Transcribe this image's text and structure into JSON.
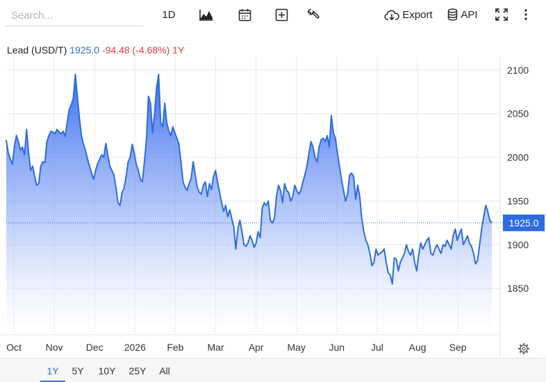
{
  "toolbar": {
    "search_placeholder": "Search...",
    "interval_label": "1D",
    "export_label": "Export",
    "api_label": "API",
    "icons": [
      "area-chart-icon",
      "calendar-icon",
      "plus-box-icon",
      "wrench-icon",
      "cloud-download-icon",
      "database-icon",
      "fullscreen-icon",
      "more-vertical-icon"
    ]
  },
  "instrument": {
    "name": "Lead (USD/T)",
    "price": "1925.0",
    "change": "-94.48 (-4.68%)",
    "range": "1Y"
  },
  "range_buttons": [
    {
      "label": "1Y",
      "active": true
    },
    {
      "label": "5Y",
      "active": false
    },
    {
      "label": "10Y",
      "active": false
    },
    {
      "label": "25Y",
      "active": false
    },
    {
      "label": "All",
      "active": false
    }
  ],
  "colors": {
    "line": "#2d6cdf",
    "area_top": "#2f66f0",
    "area_bottom": "#ffffff",
    "price_tag": "#2d6cdf",
    "negative": "#e23c3c",
    "grid": "#e8e8e8"
  },
  "chart_data": {
    "type": "area",
    "y_ticks": [
      2100,
      2050,
      2000,
      1950,
      1900,
      1850
    ],
    "ylim": [
      1800,
      2115
    ],
    "x_tick_labels": [
      "Oct",
      "Nov",
      "Dec",
      "2026",
      "Feb",
      "Mar",
      "Apr",
      "May",
      "Jun",
      "Jul",
      "Aug",
      "Sep"
    ],
    "current_value": 1925.0,
    "current_label": "1925.0",
    "grid": true,
    "series": [
      {
        "values": [
          2020,
          2005,
          1998,
          1992,
          2012,
          2025,
          2018,
          2008,
          2012,
          2003,
          2032,
          2005,
          1985,
          1990,
          1978,
          1968,
          1970,
          1990,
          1995,
          1994,
          2018,
          2025,
          2030,
          2029,
          2027,
          2032,
          2029,
          2027,
          2030,
          2024,
          2040,
          2055,
          2060,
          2068,
          2095,
          2070,
          2045,
          2025,
          2015,
          2008,
          1998,
          1990,
          1982,
          1975,
          1985,
          1993,
          1998,
          2003,
          2000,
          2016,
          2002,
          1990,
          1985,
          1980,
          1965,
          1948,
          1945,
          1960,
          1965,
          1978,
          1995,
          2000,
          2015,
          2005,
          1992,
          1985,
          1975,
          1972,
          1995,
          2020,
          2070,
          2062,
          2028,
          2050,
          2080,
          2095,
          2040,
          2035,
          2062,
          2040,
          2030,
          2025,
          2035,
          2028,
          2022,
          2015,
          1995,
          1972,
          1966,
          1962,
          1970,
          1976,
          1995,
          1980,
          1966,
          1960,
          1958,
          1968,
          1972,
          1955,
          1970,
          1963,
          1978,
          1985,
          1972,
          1960,
          1948,
          1938,
          1945,
          1932,
          1940,
          1930,
          1920,
          1895,
          1918,
          1928,
          1915,
          1900,
          1898,
          1902,
          1910,
          1905,
          1897,
          1902,
          1915,
          1908,
          1942,
          1948,
          1945,
          1950,
          1928,
          1925,
          1930,
          1955,
          1968,
          1962,
          1948,
          1970,
          1962,
          1960,
          1950,
          1955,
          1968,
          1962,
          1958,
          1962,
          1972,
          1980,
          1990,
          2005,
          2018,
          2012,
          2000,
          1995,
          2012,
          2020,
          2022,
          2018,
          2025,
          2012,
          2048,
          2028,
          2022,
          2005,
          1990,
          1975,
          1962,
          1950,
          1958,
          1980,
          1982,
          1978,
          1952,
          1968,
          1955,
          1930,
          1915,
          1905,
          1900,
          1890,
          1876,
          1880,
          1895,
          1888,
          1890,
          1892,
          1895,
          1880,
          1868,
          1865,
          1855,
          1885,
          1883,
          1870,
          1880,
          1885,
          1890,
          1900,
          1892,
          1888,
          1895,
          1880,
          1870,
          1888,
          1902,
          1895,
          1900,
          1905,
          1908,
          1890,
          1888,
          1895,
          1900,
          1895,
          1890,
          1900,
          1898,
          1905,
          1900,
          1895,
          1910,
          1918,
          1905,
          1912,
          1918,
          1900,
          1905,
          1910,
          1902,
          1898,
          1890,
          1878,
          1882,
          1900,
          1918,
          1932,
          1945,
          1938,
          1928,
          1925
        ]
      }
    ]
  }
}
